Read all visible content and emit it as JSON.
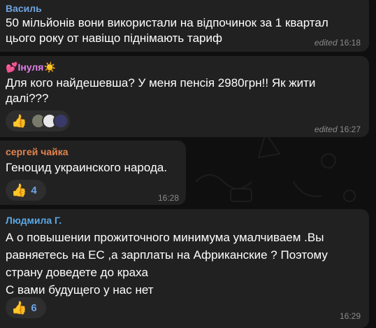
{
  "messages": [
    {
      "author": "Василь",
      "author_color": "#6fa3e0",
      "text_lines": [
        "50 мільйонів вони використали на відпочинок за 1 квартал",
        "цього року от навіщо піднімають тариф"
      ],
      "edited_label": "edited",
      "time": "16:18"
    },
    {
      "author": "Інуля",
      "author_prefix_icon": "two-hearts-icon",
      "author_suffix_icon": "sun-icon",
      "author_color": "#e37ee8",
      "text_lines": [
        "Для кого найдешевша? У меня пенсія 2980грн!! Як жити",
        "далі???"
      ],
      "reaction_icon": "thumbs-up-icon",
      "edited_label": "edited",
      "time": "16:27"
    },
    {
      "author": "сергей чайка",
      "author_color": "#e3834e",
      "text_lines": [
        "Геноцид украинского народа."
      ],
      "reaction_icon": "thumbs-up-icon",
      "reaction_count": "4",
      "time": "16:28"
    },
    {
      "author": "Людмила Г.",
      "author_color": "#5aa9e6",
      "text_lines": [
        "А о повышении прожиточного минимума умалчиваем .Вы",
        "равняетесь на ЕС ,а зарплаты на Африканские ? Поэтому",
        "страну доведете до краха",
        "С вами будущего у нас нет"
      ],
      "reaction_icon": "thumbs-up-icon",
      "reaction_count": "6",
      "time": "16:29"
    }
  ],
  "colors": {
    "bubble": "#212121",
    "background": "#0f0f10",
    "reaction_count": "#6ea5e8",
    "meta": "#8a8a8a"
  }
}
